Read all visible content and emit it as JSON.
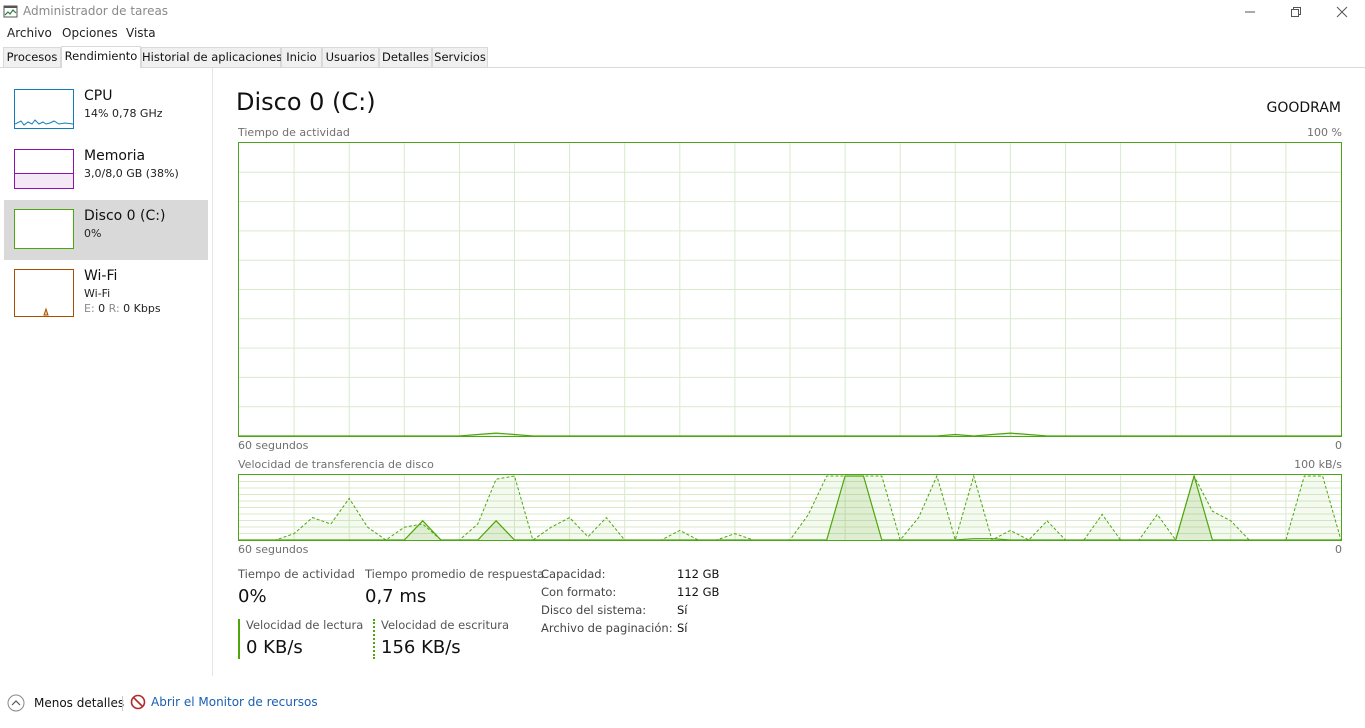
{
  "window": {
    "title": "Administrador de tareas"
  },
  "menu": [
    "Archivo",
    "Opciones",
    "Vista"
  ],
  "tabs": [
    "Procesos",
    "Rendimiento",
    "Historial de aplicaciones",
    "Inicio",
    "Usuarios",
    "Detalles",
    "Servicios"
  ],
  "active_tab": "Rendimiento",
  "sidebar": {
    "cpu": {
      "name": "CPU",
      "detail": "14% 0,78 GHz",
      "color": "#117dbb"
    },
    "memory": {
      "name": "Memoria",
      "detail": "3,0/8,0 GB (38%)",
      "color": "#8b12ae"
    },
    "disk": {
      "name": "Disco 0 (C:)",
      "detail": "0%",
      "color": "#4da60c"
    },
    "wifi": {
      "name": "Wi-Fi",
      "detail": "Wi-Fi",
      "send_label": "E:",
      "send_value": "0",
      "recv_label": "R:",
      "recv_value": "0 Kbps",
      "color": "#a74f01"
    }
  },
  "main": {
    "title": "Disco 0 (C:)",
    "model": "GOODRAM",
    "activity_chart": {
      "label": "Tiempo de actividad",
      "max_label": "100 %",
      "time_label": "60 segundos",
      "min_label": "0"
    },
    "transfer_chart": {
      "label": "Velocidad de transferencia de disco",
      "max_label": "100 kB/s",
      "time_label": "60 segundos",
      "min_label": "0"
    },
    "stats": {
      "activity": {
        "label": "Tiempo de actividad",
        "value": "0%"
      },
      "response": {
        "label": "Tiempo promedio de respuesta",
        "value": "0,7 ms"
      },
      "read": {
        "label": "Velocidad de lectura",
        "value": "0 KB/s"
      },
      "write": {
        "label": "Velocidad de escritura",
        "value": "156 KB/s"
      }
    },
    "properties": [
      {
        "key": "Capacidad:",
        "value": "112 GB"
      },
      {
        "key": "Con formato:",
        "value": "112 GB"
      },
      {
        "key": "Disco del sistema:",
        "value": "Sí"
      },
      {
        "key": "Archivo de paginación:",
        "value": "Sí"
      }
    ]
  },
  "footer": {
    "less_details": "Menos detalles",
    "resource_monitor": "Abrir el Monitor de recursos"
  },
  "colors": {
    "disk": "#4da60c",
    "grid": "#d9eacb",
    "link": "#1a5fb4"
  },
  "chart_data": [
    {
      "type": "area",
      "title": "Tiempo de actividad",
      "xlabel": "60 segundos",
      "xlim": [
        60,
        0
      ],
      "ylim": [
        0,
        100
      ],
      "grid": true,
      "x": [
        60,
        59,
        58,
        57,
        56,
        55,
        54,
        53,
        52,
        51,
        50,
        49,
        48,
        47,
        46,
        45,
        44,
        43,
        42,
        41,
        40,
        39,
        38,
        37,
        36,
        35,
        34,
        33,
        32,
        31,
        30,
        29,
        28,
        27,
        26,
        25,
        24,
        23,
        22,
        21,
        20,
        19,
        18,
        17,
        16,
        15,
        14,
        13,
        12,
        11,
        10,
        9,
        8,
        7,
        6,
        5,
        4,
        3,
        2,
        1,
        0
      ],
      "series": [
        {
          "values": [
            0,
            0,
            0,
            0,
            0,
            0,
            0,
            0,
            0,
            0,
            0,
            0,
            0,
            0.5,
            1,
            0.5,
            0,
            0,
            0,
            0,
            0,
            0,
            0,
            0,
            0,
            0,
            0,
            0,
            0,
            0,
            0,
            0,
            0,
            0,
            0,
            0,
            0,
            0,
            0,
            0.5,
            0,
            0.5,
            1,
            0.5,
            0,
            0,
            0,
            0,
            0,
            0,
            0,
            0,
            0,
            0,
            0,
            0,
            0,
            0,
            0,
            0,
            0,
            0.5,
            0.5,
            0.5,
            0,
            0,
            0,
            0,
            0.5,
            0.5,
            0
          ]
        }
      ]
    },
    {
      "type": "area",
      "title": "Velocidad de transferencia de disco",
      "xlabel": "60 segundos",
      "xlim": [
        60,
        0
      ],
      "ylim": [
        0,
        100
      ],
      "grid": true,
      "x": [
        60,
        59,
        58,
        57,
        56,
        55,
        54,
        53,
        52,
        51,
        50,
        49,
        48,
        47,
        46,
        45,
        44,
        43,
        42,
        41,
        40,
        39,
        38,
        37,
        36,
        35,
        34,
        33,
        32,
        31,
        30,
        29,
        28,
        27,
        26,
        25,
        24,
        23,
        22,
        21,
        20,
        19,
        18,
        17,
        16,
        15,
        14,
        13,
        12,
        11,
        10,
        9,
        8,
        7,
        6,
        5,
        4,
        3,
        2,
        1,
        0
      ],
      "series": [
        {
          "name": "Velocidad de lectura",
          "values": [
            0,
            0,
            0,
            0,
            0,
            0,
            0,
            0,
            0,
            0,
            30,
            0,
            0,
            0,
            30,
            0,
            0,
            0,
            0,
            0,
            0,
            0,
            0,
            0,
            0,
            0,
            0,
            0,
            0,
            0,
            0,
            0,
            0,
            100,
            100,
            0,
            0,
            0,
            0,
            0,
            2,
            2,
            0,
            0,
            0,
            0,
            0,
            0,
            0,
            0,
            0,
            0,
            100,
            0,
            0,
            0,
            0,
            0,
            0,
            0,
            0
          ]
        },
        {
          "name": "Velocidad de escritura",
          "values": [
            0,
            0,
            0,
            10,
            35,
            25,
            65,
            20,
            0,
            20,
            25,
            0,
            0,
            25,
            95,
            100,
            0,
            20,
            35,
            5,
            35,
            0,
            0,
            0,
            15,
            0,
            0,
            10,
            0,
            0,
            0,
            40,
            100,
            100,
            100,
            100,
            0,
            35,
            100,
            0,
            100,
            0,
            15,
            0,
            30,
            0,
            0,
            40,
            0,
            0,
            40,
            0,
            100,
            45,
            30,
            0,
            0,
            0,
            100,
            100,
            0
          ]
        }
      ]
    }
  ]
}
